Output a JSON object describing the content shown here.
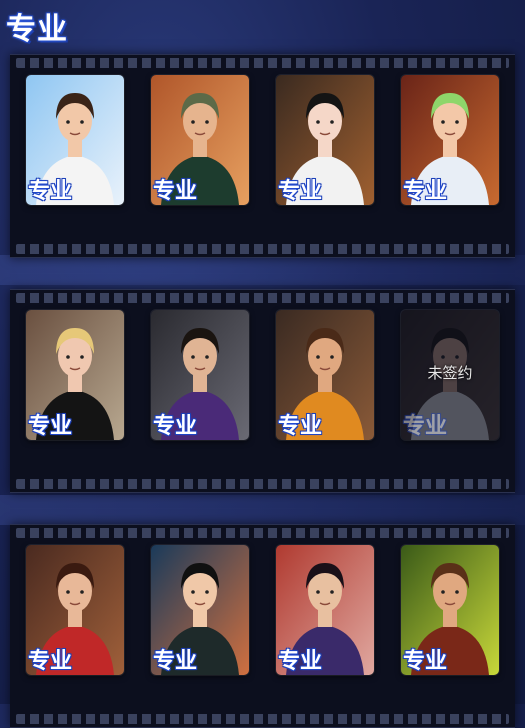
{
  "header": {
    "title": "专业"
  },
  "rows": [
    {
      "cards": [
        {
          "label": "专业",
          "locked": false,
          "bg1": "#8fc6f2",
          "bg2": "#e9f2fb",
          "skin": "#f2c8a8",
          "hair": "#3a2418",
          "cloth": "#f4f4f4"
        },
        {
          "label": "专业",
          "locked": false,
          "bg1": "#b0562a",
          "bg2": "#e7a060",
          "skin": "#e6b48e",
          "hair": "#5c6a48",
          "cloth": "#1d3c2e"
        },
        {
          "label": "专业",
          "locked": false,
          "bg1": "#3a2a20",
          "bg2": "#a06030",
          "skin": "#f5d7c8",
          "hair": "#141414",
          "cloth": "#f2f2f2"
        },
        {
          "label": "专业",
          "locked": false,
          "bg1": "#6a2418",
          "bg2": "#c86a30",
          "skin": "#f3c8a8",
          "hair": "#8ed66a",
          "cloth": "#e8eef6"
        }
      ]
    },
    {
      "cards": [
        {
          "label": "专业",
          "locked": false,
          "bg1": "#6a5040",
          "bg2": "#b8a890",
          "skin": "#f0c8b0",
          "hair": "#e6c878",
          "cloth": "#141414"
        },
        {
          "label": "专业",
          "locked": false,
          "bg1": "#2a2a30",
          "bg2": "#6a6a74",
          "skin": "#e0b494",
          "hair": "#1a1410",
          "cloth": "#4a2a78"
        },
        {
          "label": "专业",
          "locked": false,
          "bg1": "#3a2a22",
          "bg2": "#8a5a38",
          "skin": "#e0a880",
          "hair": "#4a2a18",
          "cloth": "#e08a20"
        },
        {
          "label": "专业",
          "locked": true,
          "overlay": "未签约",
          "bg1": "#2a2220",
          "bg2": "#5a4a40",
          "skin": "#c8a08a",
          "hair": "#1a1410",
          "cloth": "#d8d8d8"
        }
      ]
    },
    {
      "cards": [
        {
          "label": "专业",
          "locked": false,
          "bg1": "#4a2a20",
          "bg2": "#a0603a",
          "skin": "#e8b898",
          "hair": "#3a1a10",
          "cloth": "#c02828"
        },
        {
          "label": "专业",
          "locked": false,
          "bg1": "#1a3a5a",
          "bg2": "#d07040",
          "skin": "#f0c8a8",
          "hair": "#101010",
          "cloth": "#1e2a2a"
        },
        {
          "label": "专业",
          "locked": false,
          "bg1": "#b03a30",
          "bg2": "#e0a8a0",
          "skin": "#e8c0a0",
          "hair": "#1a1018",
          "cloth": "#3a2a6a"
        },
        {
          "label": "专业",
          "locked": false,
          "bg1": "#3a5a18",
          "bg2": "#c8d83a",
          "skin": "#e0a880",
          "hair": "#5a3018",
          "cloth": "#7a2818"
        }
      ]
    }
  ]
}
